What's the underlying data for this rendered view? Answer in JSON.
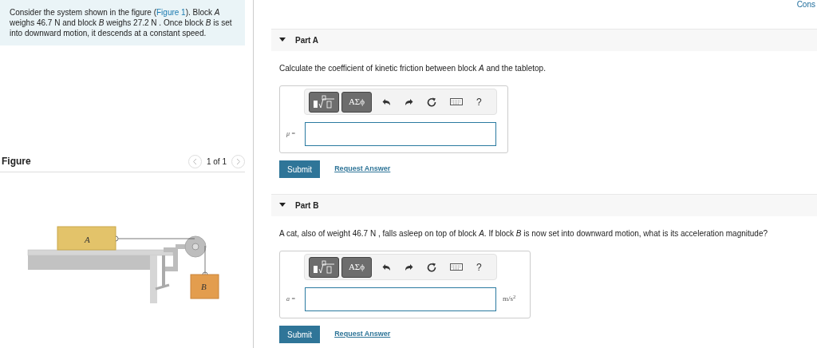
{
  "top_link": "Cons",
  "intro": {
    "before": "Consider the system shown in the figure (",
    "link": "Figure 1",
    "after": "). Block *A* weighs 46.7 N and block *B* weighs 27.2 N . Once block *B* is set into downward motion, it descends at a constant speed."
  },
  "figure": {
    "title": "Figure",
    "pager": "1 of 1",
    "block_labels": [
      "A",
      "B"
    ]
  },
  "parts": [
    {
      "title": "Part A",
      "expanded": true,
      "question": "Calculate the coefficient of kinetic friction between block *A* and the tabletop.",
      "toolbar": {
        "greek": "ΑΣϕ",
        "help": "?"
      },
      "variable": "μ =",
      "submit": "Submit",
      "request": "Request Answer"
    },
    {
      "title": "Part B",
      "expanded": true,
      "question": "A cat, also of weight 46.7 N , falls asleep on top of block *A*. If block *B* is now set into downward motion, what is its acceleration magnitude?",
      "toolbar": {
        "greek": "ΑΣϕ",
        "help": "?"
      },
      "variable": "a =",
      "unit": "m/s$^{2}$",
      "submit": "Submit",
      "request": "Request Answer"
    }
  ]
}
